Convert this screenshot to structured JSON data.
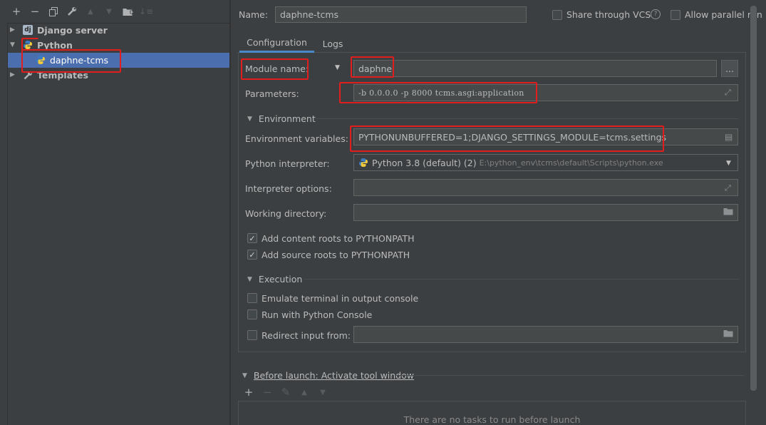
{
  "left_toolbar": {
    "icons": [
      "add-icon",
      "remove-icon",
      "copy-icon",
      "wrench-icon",
      "move-up-icon",
      "move-down-icon",
      "new-folder-icon",
      "sort-icon"
    ]
  },
  "tree": {
    "django_server": "Django server",
    "python": "Python",
    "daphne_tcms": "daphne-tcms",
    "templates": "Templates"
  },
  "header": {
    "name_label": "Name:",
    "name_value": "daphne-tcms",
    "share_vcs": "Share through VCS",
    "allow_parallel": "Allow parallel run"
  },
  "tabs": [
    "Configuration",
    "Logs"
  ],
  "form": {
    "module_name_label": "Module name:",
    "module_name_value": "daphne",
    "more_button": "...",
    "parameters_label": "Parameters:",
    "parameters_value": "-b 0.0.0.0 -p 8000 tcms.asgi:application",
    "environment_section": "Environment",
    "env_vars_label": "Environment variables:",
    "env_vars_value": "PYTHONUNBUFFERED=1;DJANGO_SETTINGS_MODULE=tcms.settings",
    "interpreter_label": "Python interpreter:",
    "interpreter_name": "Python 3.8 (default) (2)",
    "interpreter_path": "E:\\python_env\\tcms\\default\\Scripts\\python.exe",
    "interp_options_label": "Interpreter options:",
    "working_dir_label": "Working directory:",
    "add_content_roots": "Add content roots to PYTHONPATH",
    "add_source_roots": "Add source roots to PYTHONPATH",
    "execution_section": "Execution",
    "emulate_terminal": "Emulate terminal in output console",
    "run_python_console": "Run with Python Console",
    "redirect_input": "Redirect input from:"
  },
  "before_launch": {
    "title": "Before launch: Activate tool window",
    "empty_text": "There are no tasks to run before launch"
  },
  "checkboxes": {
    "share_vcs": false,
    "allow_parallel": false,
    "add_content_roots": true,
    "add_source_roots": true,
    "emulate_terminal": false,
    "run_python_console": false,
    "redirect_input": false
  },
  "colors": {
    "selection": "#4b6eaf",
    "annotation_red": "#e01e1e",
    "tab_underline": "#4a88c7"
  }
}
